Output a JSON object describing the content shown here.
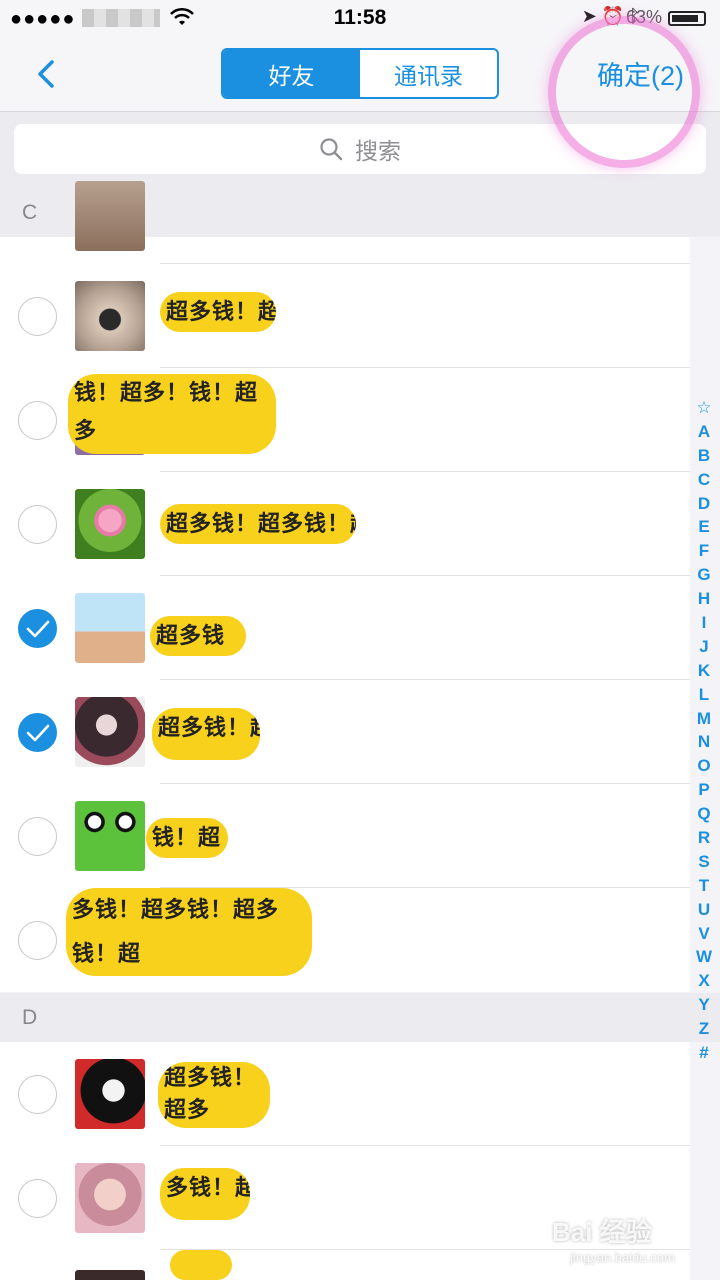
{
  "status_bar": {
    "time": "11:58",
    "battery_text": "63%",
    "signal_dots": "●●●●●"
  },
  "nav": {
    "tabs": [
      "好友",
      "通讯录"
    ],
    "active_tab": 0,
    "confirm_label": "确定(2)"
  },
  "search": {
    "placeholder": "搜索"
  },
  "sections": [
    {
      "letter": "C"
    },
    {
      "letter": "D"
    }
  ],
  "contacts": [
    {
      "section": "C",
      "checked": false,
      "avatar": "cat-photo",
      "name_mask": "超多钱！超"
    },
    {
      "section": "C",
      "checked": false,
      "avatar": "portrait-photo",
      "name_mask": "钱！超多！钱！超多"
    },
    {
      "section": "C",
      "checked": false,
      "avatar": "lotus-photo",
      "name_mask": "超多钱！超多钱！超"
    },
    {
      "section": "C",
      "checked": true,
      "avatar": "cartoon-girl",
      "name_mask": "超多钱"
    },
    {
      "section": "C",
      "checked": true,
      "avatar": "anime-girl",
      "name_mask": "超多钱！超"
    },
    {
      "section": "C",
      "checked": false,
      "avatar": "frog-cartoon",
      "name_mask": "钱！超"
    },
    {
      "section": "C",
      "checked": false,
      "avatar": "masked-photo",
      "name_mask": "多钱！超多钱！超多钱！超"
    },
    {
      "section": "D",
      "checked": false,
      "avatar": "goth-girl",
      "name_mask": "超多钱！超多"
    },
    {
      "section": "D",
      "checked": false,
      "avatar": "man-photo",
      "name_mask": "多钱！超"
    }
  ],
  "index_letters": [
    "☆",
    "A",
    "B",
    "C",
    "D",
    "E",
    "F",
    "G",
    "H",
    "I",
    "J",
    "K",
    "L",
    "M",
    "N",
    "O",
    "P",
    "Q",
    "R",
    "S",
    "T",
    "U",
    "V",
    "W",
    "X",
    "Y",
    "Z",
    "#"
  ],
  "watermark": {
    "brand": "Bai 经验",
    "url": "jingyan.baidu.com"
  },
  "colors": {
    "accent": "#1b8fe0",
    "mask_yellow": "#f7d11b",
    "highlight_pink": "#ec6ed2"
  }
}
